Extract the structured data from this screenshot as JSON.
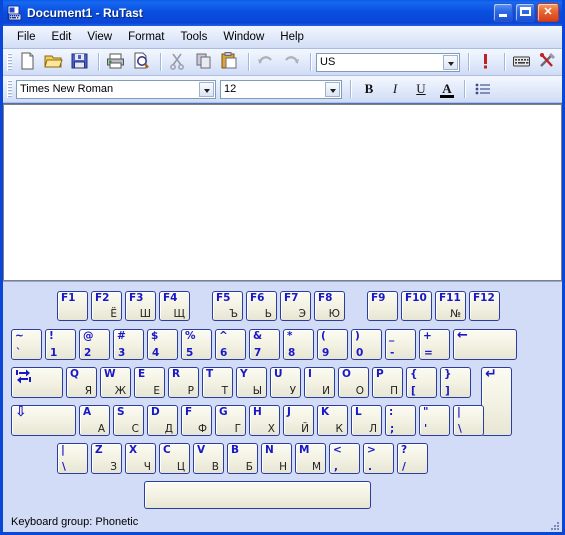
{
  "window": {
    "title": "Document1 - RuTast",
    "app_icon": "document-keyboard-icon",
    "buttons": {
      "minimize": "Minimize",
      "maximize": "Maximize",
      "close": "Close"
    }
  },
  "menu": {
    "items": [
      {
        "label": "File"
      },
      {
        "label": "Edit"
      },
      {
        "label": "View"
      },
      {
        "label": "Format"
      },
      {
        "label": "Tools"
      },
      {
        "label": "Window"
      },
      {
        "label": "Help"
      }
    ]
  },
  "toolbar_standard": {
    "buttons": [
      {
        "name": "new-document-icon",
        "title": "New"
      },
      {
        "name": "open-folder-icon",
        "title": "Open"
      },
      {
        "name": "save-floppy-icon",
        "title": "Save"
      },
      {
        "name": "print-icon",
        "title": "Print"
      },
      {
        "name": "print-preview-icon",
        "title": "Print Preview"
      },
      {
        "name": "cut-scissors-icon",
        "title": "Cut"
      },
      {
        "name": "copy-icon",
        "title": "Copy"
      },
      {
        "name": "paste-clipboard-icon",
        "title": "Paste"
      },
      {
        "name": "undo-arrow-icon",
        "title": "Undo"
      },
      {
        "name": "redo-arrow-icon",
        "title": "Redo"
      }
    ],
    "keyboard_layout_combo": {
      "value": "US",
      "placeholder": "US"
    },
    "right_buttons": [
      {
        "name": "insert-symbol-icon",
        "title": "Insert Symbol"
      },
      {
        "name": "keyboard-icon",
        "title": "Keyboard"
      },
      {
        "name": "tools-icon",
        "title": "Options"
      }
    ]
  },
  "toolbar_format": {
    "font_combo": {
      "value": "Times New Roman"
    },
    "size_combo": {
      "value": "12"
    },
    "bold": "B",
    "italic": "I",
    "underline": "U",
    "font_color": "A",
    "bullets": "bullet-list-icon"
  },
  "document": {
    "content": ""
  },
  "statusbar": {
    "text": "Keyboard group:  Phonetic"
  },
  "keyboard": {
    "function_row": [
      {
        "top": "F1",
        "bottom": ""
      },
      {
        "top": "F2",
        "bottom": "Ё"
      },
      {
        "top": "F3",
        "bottom": "Ш"
      },
      {
        "top": "F4",
        "bottom": "Щ"
      },
      {
        "top": "F5",
        "bottom": "Ъ"
      },
      {
        "top": "F6",
        "bottom": "Ь"
      },
      {
        "top": "F7",
        "bottom": "Э"
      },
      {
        "top": "F8",
        "bottom": "Ю"
      },
      {
        "top": "F9",
        "bottom": ""
      },
      {
        "top": "F10",
        "bottom": ""
      },
      {
        "top": "F11",
        "bottom": "№"
      },
      {
        "top": "F12",
        "bottom": ""
      }
    ],
    "number_row": [
      {
        "top": "~",
        "bottom": "`",
        "blue": true
      },
      {
        "top": "!",
        "bottom": "1",
        "blue": true
      },
      {
        "top": "@",
        "bottom": "2",
        "blue": true
      },
      {
        "top": "#",
        "bottom": "3",
        "blue": true
      },
      {
        "top": "$",
        "bottom": "4",
        "blue": true
      },
      {
        "top": "%",
        "bottom": "5",
        "blue": true
      },
      {
        "top": "^",
        "bottom": "6",
        "blue": true
      },
      {
        "top": "&",
        "bottom": "7",
        "blue": true
      },
      {
        "top": "*",
        "bottom": "8",
        "blue": true
      },
      {
        "top": "(",
        "bottom": "9",
        "blue": true
      },
      {
        "top": ")",
        "bottom": "0",
        "blue": true
      },
      {
        "top": "_",
        "bottom": "-",
        "blue": true
      },
      {
        "top": "+",
        "bottom": "=",
        "blue": true
      }
    ],
    "backspace": {
      "glyph": "←",
      "name": "backspace-key"
    },
    "tab": {
      "glyph": "tab-icon",
      "name": "tab-key"
    },
    "qwerty_row": [
      {
        "top": "Q",
        "bottom": "Я"
      },
      {
        "top": "W",
        "bottom": "Ж"
      },
      {
        "top": "E",
        "bottom": "Е"
      },
      {
        "top": "R",
        "bottom": "Р"
      },
      {
        "top": "T",
        "bottom": "Т"
      },
      {
        "top": "Y",
        "bottom": "Ы"
      },
      {
        "top": "U",
        "bottom": "У"
      },
      {
        "top": "I",
        "bottom": "И"
      },
      {
        "top": "O",
        "bottom": "О"
      },
      {
        "top": "P",
        "bottom": "П"
      },
      {
        "top": "{",
        "bottom": "[",
        "blue": true
      },
      {
        "top": "}",
        "bottom": "]",
        "blue": true
      }
    ],
    "enter": {
      "glyph": "↵",
      "name": "enter-key"
    },
    "capslock": {
      "glyph": "⇩",
      "name": "caps-lock-key"
    },
    "home_row": [
      {
        "top": "A",
        "bottom": "А"
      },
      {
        "top": "S",
        "bottom": "С"
      },
      {
        "top": "D",
        "bottom": "Д"
      },
      {
        "top": "F",
        "bottom": "Ф"
      },
      {
        "top": "G",
        "bottom": "Г"
      },
      {
        "top": "H",
        "bottom": "Х"
      },
      {
        "top": "J",
        "bottom": "Й"
      },
      {
        "top": "K",
        "bottom": "К"
      },
      {
        "top": "L",
        "bottom": "Л"
      },
      {
        "top": ":",
        "bottom": ";",
        "blue": true
      },
      {
        "top": "\"",
        "bottom": "'",
        "blue": true
      },
      {
        "top": "|",
        "bottom": "\\",
        "blue": true
      }
    ],
    "bottom_row": [
      {
        "top": "|",
        "bottom": "\\",
        "blue": true
      },
      {
        "top": "Z",
        "bottom": "З"
      },
      {
        "top": "X",
        "bottom": "Ч"
      },
      {
        "top": "C",
        "bottom": "Ц"
      },
      {
        "top": "V",
        "bottom": "В"
      },
      {
        "top": "B",
        "bottom": "Б"
      },
      {
        "top": "N",
        "bottom": "Н"
      },
      {
        "top": "M",
        "bottom": "М"
      },
      {
        "top": "<",
        "bottom": ",",
        "blue": true
      },
      {
        "top": ">",
        "bottom": ".",
        "blue": true
      },
      {
        "top": "?",
        "bottom": "/",
        "blue": true
      }
    ],
    "spacebar": {
      "name": "space-key",
      "label": ""
    }
  },
  "colors": {
    "titlebar": "#0B45D6",
    "panel": "#D2DCF7",
    "key_face": "#F2F1E2",
    "key_border": "#2B3E9E",
    "legend_blue": "#1818C8"
  }
}
